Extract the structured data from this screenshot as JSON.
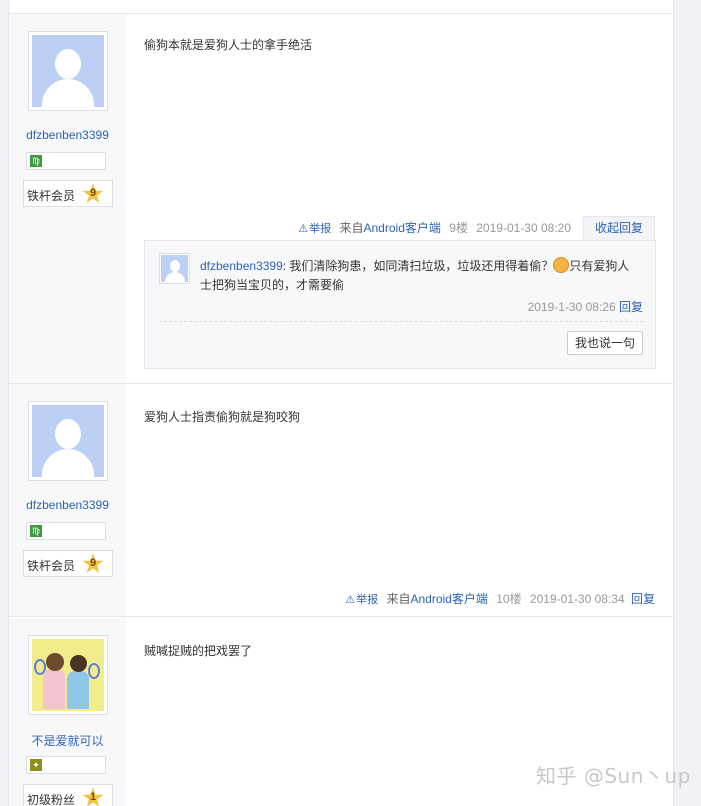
{
  "posts": [
    {
      "username": "dfzbenben3399",
      "level_name": "铁杆会员",
      "level_num": "9",
      "content": "偷狗本就是爱狗人士的拿手绝活",
      "report": "举报",
      "client": "来自",
      "client_name": "Android客户端",
      "floor": "9楼",
      "time": "2019-01-30 08:20",
      "reply_toggle": "收起回复",
      "lzl": {
        "username": "dfzbenben3399",
        "text_before_emoji": ": 我们清除狗患，如同清扫垃圾，垃圾还用得着偷？",
        "text_after_emoji": "只有爱狗人士把狗当宝贝的，才需要偷",
        "time": "2019-1-30 08:26",
        "reply": "回复",
        "say_button": "我也说一句"
      }
    },
    {
      "username": "dfzbenben3399",
      "level_name": "铁杆会员",
      "level_num": "9",
      "content": "爱狗人士指责偷狗就是狗咬狗",
      "report": "举报",
      "client": "来自",
      "client_name": "Android客户端",
      "floor": "10楼",
      "time": "2019-01-30 08:34",
      "reply_toggle": "回复"
    },
    {
      "username": "不是爱就可以",
      "level_name": "初级粉丝",
      "level_num": "1",
      "content": "贼喊捉贼的把戏罢了"
    }
  ],
  "watermark": "知乎 @Sun丶up"
}
